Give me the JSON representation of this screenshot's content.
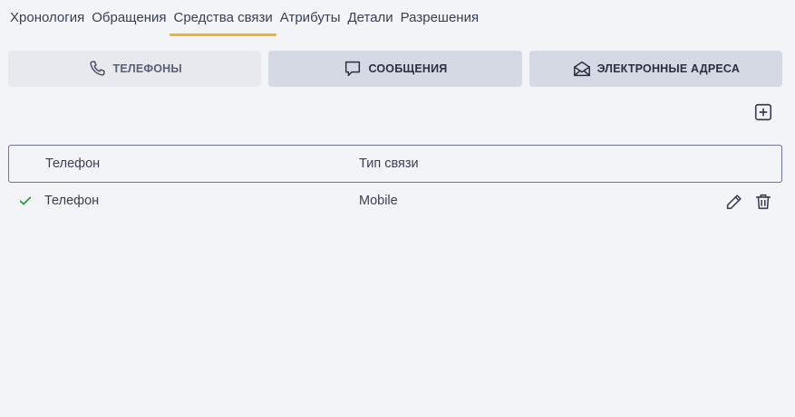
{
  "tabs": [
    {
      "label": "Хронология"
    },
    {
      "label": "Обращения"
    },
    {
      "label": "Средства связи",
      "active": true
    },
    {
      "label": "Атрибуты"
    },
    {
      "label": "Детали"
    },
    {
      "label": "Разрешения"
    }
  ],
  "segments": {
    "phones": {
      "label": "ТЕЛЕФОНЫ",
      "icon": "phone-icon",
      "active": true
    },
    "messages": {
      "label": "СООБЩЕНИЯ",
      "icon": "message-icon"
    },
    "emails": {
      "label": "ЭЛЕКТРОННЫЕ АДРЕСА",
      "icon": "envelope-icon"
    }
  },
  "table": {
    "columns": [
      "Телефон",
      "Тип связи"
    ],
    "rows": [
      {
        "phone": "Телефон",
        "type": "Mobile",
        "primary": true
      }
    ]
  },
  "colors": {
    "accent": "#f0b323",
    "check": "#2e9b3a",
    "segment_bg": "#d5d9e4",
    "segment_active_bg": "#e7e9ef"
  }
}
